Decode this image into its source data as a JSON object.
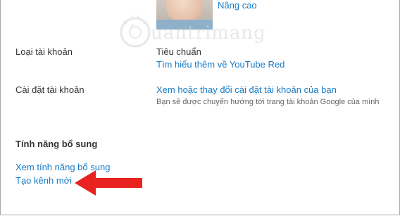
{
  "profile": {
    "advanced_link": "Nâng cao"
  },
  "account_type": {
    "label": "Loại tài khoản",
    "value": "Tiêu chuẩn",
    "learn_more_link": "Tìm hiểu thêm về YouTube Red"
  },
  "account_settings": {
    "label": "Cài đặt tài khoản",
    "link": "Xem hoặc thay đổi cài đặt tài khoản của bạn",
    "note": "Bạn sẽ được chuyển hướng tới trang tài khoản Google của mình"
  },
  "additional_features": {
    "heading": "Tính năng bổ sung",
    "view_features_link": "Xem tính năng bổ sung",
    "create_channel_link": "Tạo kênh mới"
  },
  "watermark": {
    "text": "uantrimang"
  },
  "colors": {
    "link": "#167ac6",
    "arrow": "#e8231f",
    "text": "#333333"
  }
}
